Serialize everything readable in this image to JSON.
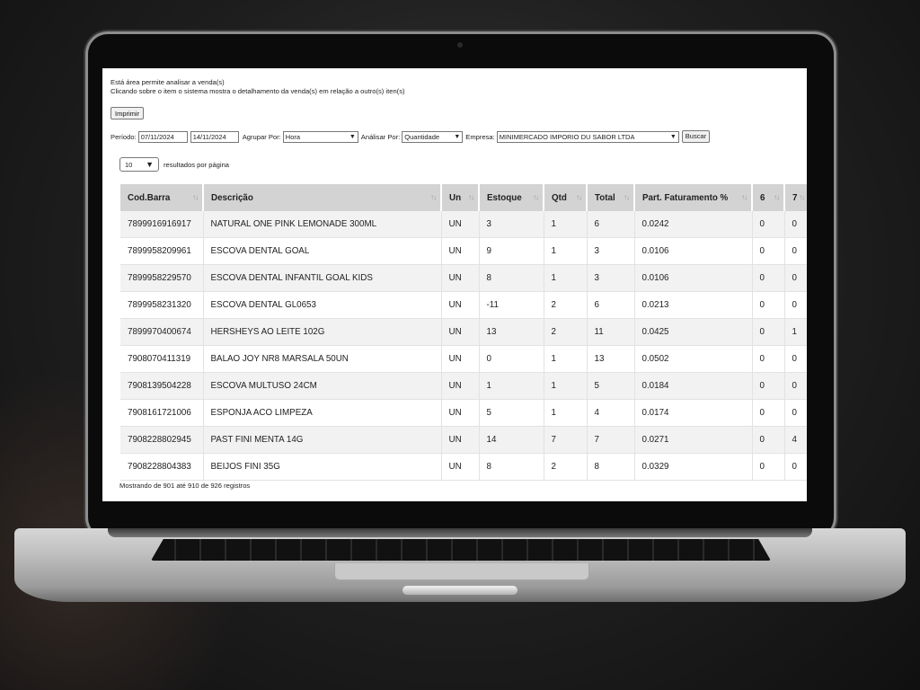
{
  "intro": {
    "line1": "Está área permite analisar a venda(s)",
    "line2": "Clicando sobre o item o sistema mostra o detalhamento da venda(s) em relação a outro(s) iten(s)"
  },
  "print_label": "Imprimir",
  "filters": {
    "periodo_label": "Período:",
    "date_from": "07/11/2024",
    "date_to": "14/11/2024",
    "agrupar_label": "Agrupar Por:",
    "agrupar_value": "Hora",
    "analisar_label": "Análisar Por:",
    "analisar_value": "Quantidade",
    "empresa_label": "Empresa:",
    "empresa_value": "MINIMERCADO IMPORIO DU SABOR LTDA",
    "buscar_label": "Buscar"
  },
  "page_size": {
    "value": "10",
    "label": "resultados por página"
  },
  "table": {
    "columns": [
      "Cod.Barra",
      "Descrição",
      "Un",
      "Estoque",
      "Qtd",
      "Total",
      "Part. Faturamento %",
      "6",
      "7"
    ],
    "rows": [
      [
        "7899916916917",
        "NATURAL ONE PINK LEMONADE 300ML",
        "UN",
        "3",
        "1",
        "6",
        "0.0242",
        "0",
        "0"
      ],
      [
        "7899958209961",
        "ESCOVA DENTAL GOAL",
        "UN",
        "9",
        "1",
        "3",
        "0.0106",
        "0",
        "0"
      ],
      [
        "7899958229570",
        "ESCOVA DENTAL INFANTIL GOAL KIDS",
        "UN",
        "8",
        "1",
        "3",
        "0.0106",
        "0",
        "0"
      ],
      [
        "7899958231320",
        "ESCOVA DENTAL GL0653",
        "UN",
        "-11",
        "2",
        "6",
        "0.0213",
        "0",
        "0"
      ],
      [
        "7899970400674",
        "HERSHEYS AO LEITE 102G",
        "UN",
        "13",
        "2",
        "11",
        "0.0425",
        "0",
        "1"
      ],
      [
        "7908070411319",
        "BALAO JOY NR8 MARSALA 50UN",
        "UN",
        "0",
        "1",
        "13",
        "0.0502",
        "0",
        "0"
      ],
      [
        "7908139504228",
        "ESCOVA MULTUSO 24CM",
        "UN",
        "1",
        "1",
        "5",
        "0.0184",
        "0",
        "0"
      ],
      [
        "7908161721006",
        "ESPONJA ACO LIMPEZA",
        "UN",
        "5",
        "1",
        "4",
        "0.0174",
        "0",
        "0"
      ],
      [
        "7908228802945",
        "PAST FINI MENTA 14G",
        "UN",
        "14",
        "7",
        "7",
        "0.0271",
        "0",
        "4"
      ],
      [
        "7908228804383",
        "BEIJOS FINI 35G",
        "UN",
        "8",
        "2",
        "8",
        "0.0329",
        "0",
        "0"
      ]
    ]
  },
  "footer_info": "Mostrando de 901 até 910 de 926 registros"
}
